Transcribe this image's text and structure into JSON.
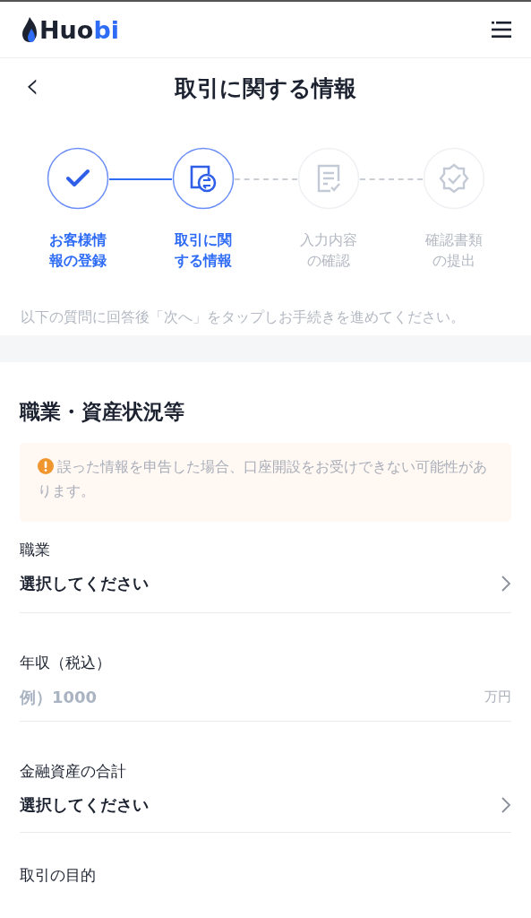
{
  "header": {
    "logo": {
      "main": "Huo",
      "accent": "bi"
    }
  },
  "title_bar": {
    "back": "‹",
    "title": "取引に関する情報"
  },
  "steps": [
    {
      "label": "お客様情報の登録",
      "reached": true
    },
    {
      "label": "取引に関する情報",
      "reached": true
    },
    {
      "label": "入力内容の確認",
      "reached": false
    },
    {
      "label": "確認書類の提出",
      "reached": false
    }
  ],
  "instruction": "以下の質問に回答後「次へ」をタップしお手続きを進めてください。",
  "section": {
    "title": "職業・資産状況等",
    "alert": "誤った情報を申告した場合、口座開設をお受けできない可能性があります。",
    "fields": [
      {
        "kind": "select",
        "label": "職業",
        "value": "選択してください"
      },
      {
        "kind": "input",
        "label": "年収（税込）",
        "placeholder": "例）1000",
        "unit": "万円"
      },
      {
        "kind": "select",
        "label": "金融資産の合計",
        "value": "選択してください"
      },
      {
        "kind": "heading",
        "label": "取引の目的"
      }
    ]
  }
}
